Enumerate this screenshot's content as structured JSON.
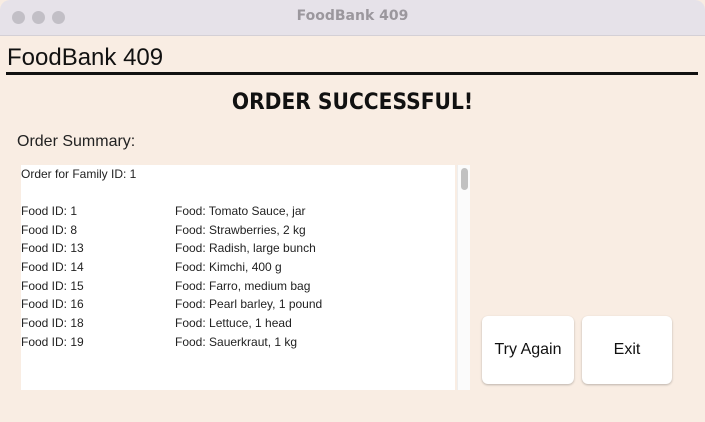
{
  "window": {
    "title": "FoodBank 409"
  },
  "app": {
    "header": "FoodBank 409",
    "status": "ORDER SUCCESSFUL!",
    "summary_label": "Order Summary:"
  },
  "summary": {
    "order_line": "Order for Family ID: 1",
    "items": [
      {
        "id": "Food ID: 1",
        "food": "Food: Tomato Sauce, jar"
      },
      {
        "id": "Food ID: 8",
        "food": "Food: Strawberries, 2 kg"
      },
      {
        "id": "Food ID: 13",
        "food": "Food: Radish, large bunch"
      },
      {
        "id": "Food ID: 14",
        "food": "Food: Kimchi, 400 g"
      },
      {
        "id": "Food ID: 15",
        "food": "Food: Farro, medium bag"
      },
      {
        "id": "Food ID: 16",
        "food": "Food: Pearl barley, 1 pound"
      },
      {
        "id": "Food ID: 18",
        "food": "Food: Lettuce, 1 head"
      },
      {
        "id": "Food ID: 19",
        "food": "Food: Sauerkraut, 1 kg"
      }
    ]
  },
  "buttons": {
    "try_again": "Try Again",
    "exit": "Exit"
  }
}
